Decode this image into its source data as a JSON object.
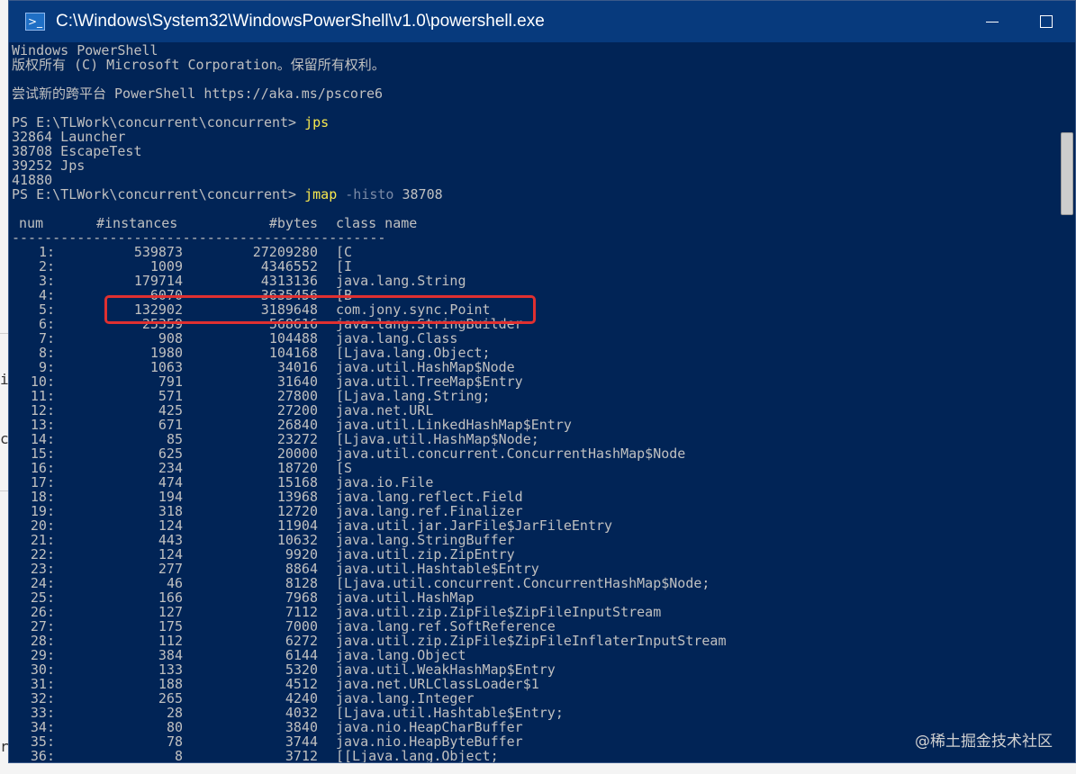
{
  "window": {
    "title": "C:\\Windows\\System32\\WindowsPowerShell\\v1.0\\powershell.exe",
    "icon_glyph": ">_"
  },
  "console": {
    "banner": [
      "Windows PowerShell",
      "版权所有 (C) Microsoft Corporation。保留所有权利。",
      "",
      "尝试新的跨平台 PowerShell https://aka.ms/pscore6",
      ""
    ],
    "prompt": "PS E:\\TLWork\\concurrent\\concurrent> ",
    "cmd1": {
      "command": "jps"
    },
    "jps_output": [
      "32864 Launcher",
      "38708 EscapeTest",
      "39252 Jps",
      "41880"
    ],
    "cmd2": {
      "command": "jmap",
      "param": "-histo",
      "arg": "38708"
    },
    "table": {
      "headers": {
        "num": "num",
        "instances": "#instances",
        "bytes": "#bytes",
        "class": "class name"
      },
      "separator": "----------------------------------------------",
      "rows": [
        [
          "1:",
          "539873",
          "27209280",
          "[C"
        ],
        [
          "2:",
          "1009",
          "4346552",
          "[I"
        ],
        [
          "3:",
          "179714",
          "4313136",
          "java.lang.String"
        ],
        [
          "4:",
          "6070",
          "3635456",
          "[B"
        ],
        [
          "5:",
          "132902",
          "3189648",
          "com.jony.sync.Point"
        ],
        [
          "6:",
          "25359",
          "568616",
          "java.lang.StringBuilder"
        ],
        [
          "7:",
          "908",
          "104488",
          "java.lang.Class"
        ],
        [
          "8:",
          "1980",
          "104168",
          "[Ljava.lang.Object;"
        ],
        [
          "9:",
          "1063",
          "34016",
          "java.util.HashMap$Node"
        ],
        [
          "10:",
          "791",
          "31640",
          "java.util.TreeMap$Entry"
        ],
        [
          "11:",
          "571",
          "27800",
          "[Ljava.lang.String;"
        ],
        [
          "12:",
          "425",
          "27200",
          "java.net.URL"
        ],
        [
          "13:",
          "671",
          "26840",
          "java.util.LinkedHashMap$Entry"
        ],
        [
          "14:",
          "85",
          "23272",
          "[Ljava.util.HashMap$Node;"
        ],
        [
          "15:",
          "625",
          "20000",
          "java.util.concurrent.ConcurrentHashMap$Node"
        ],
        [
          "16:",
          "234",
          "18720",
          "[S"
        ],
        [
          "17:",
          "474",
          "15168",
          "java.io.File"
        ],
        [
          "18:",
          "194",
          "13968",
          "java.lang.reflect.Field"
        ],
        [
          "19:",
          "318",
          "12720",
          "java.lang.ref.Finalizer"
        ],
        [
          "20:",
          "124",
          "11904",
          "java.util.jar.JarFile$JarFileEntry"
        ],
        [
          "21:",
          "443",
          "10632",
          "java.lang.StringBuffer"
        ],
        [
          "22:",
          "124",
          "9920",
          "java.util.zip.ZipEntry"
        ],
        [
          "23:",
          "277",
          "8864",
          "java.util.Hashtable$Entry"
        ],
        [
          "24:",
          "46",
          "8128",
          "[Ljava.util.concurrent.ConcurrentHashMap$Node;"
        ],
        [
          "25:",
          "166",
          "7968",
          "java.util.HashMap"
        ],
        [
          "26:",
          "127",
          "7112",
          "java.util.zip.ZipFile$ZipFileInputStream"
        ],
        [
          "27:",
          "175",
          "7000",
          "java.lang.ref.SoftReference"
        ],
        [
          "28:",
          "112",
          "6272",
          "java.util.zip.ZipFile$ZipFileInflaterInputStream"
        ],
        [
          "29:",
          "384",
          "6144",
          "java.lang.Object"
        ],
        [
          "30:",
          "133",
          "5320",
          "java.util.WeakHashMap$Entry"
        ],
        [
          "31:",
          "188",
          "4512",
          "java.net.URLClassLoader$1"
        ],
        [
          "32:",
          "265",
          "4240",
          "java.lang.Integer"
        ],
        [
          "33:",
          "28",
          "4032",
          "[Ljava.util.Hashtable$Entry;"
        ],
        [
          "34:",
          "80",
          "3840",
          "java.nio.HeapCharBuffer"
        ],
        [
          "35:",
          "78",
          "3744",
          "java.nio.HeapByteBuffer"
        ],
        [
          "36:",
          "8",
          "3712",
          "[[Ljava.lang.Object;"
        ]
      ]
    }
  },
  "background_fragments": [
    "ir",
    "co",
    "r"
  ],
  "watermark": "@稀土掘金技术社区",
  "colors": {
    "console_bg": "#012456",
    "titlebar_bg": "#073a7d",
    "command_yellow": "#f9e94e",
    "highlight_red": "#e03030"
  }
}
